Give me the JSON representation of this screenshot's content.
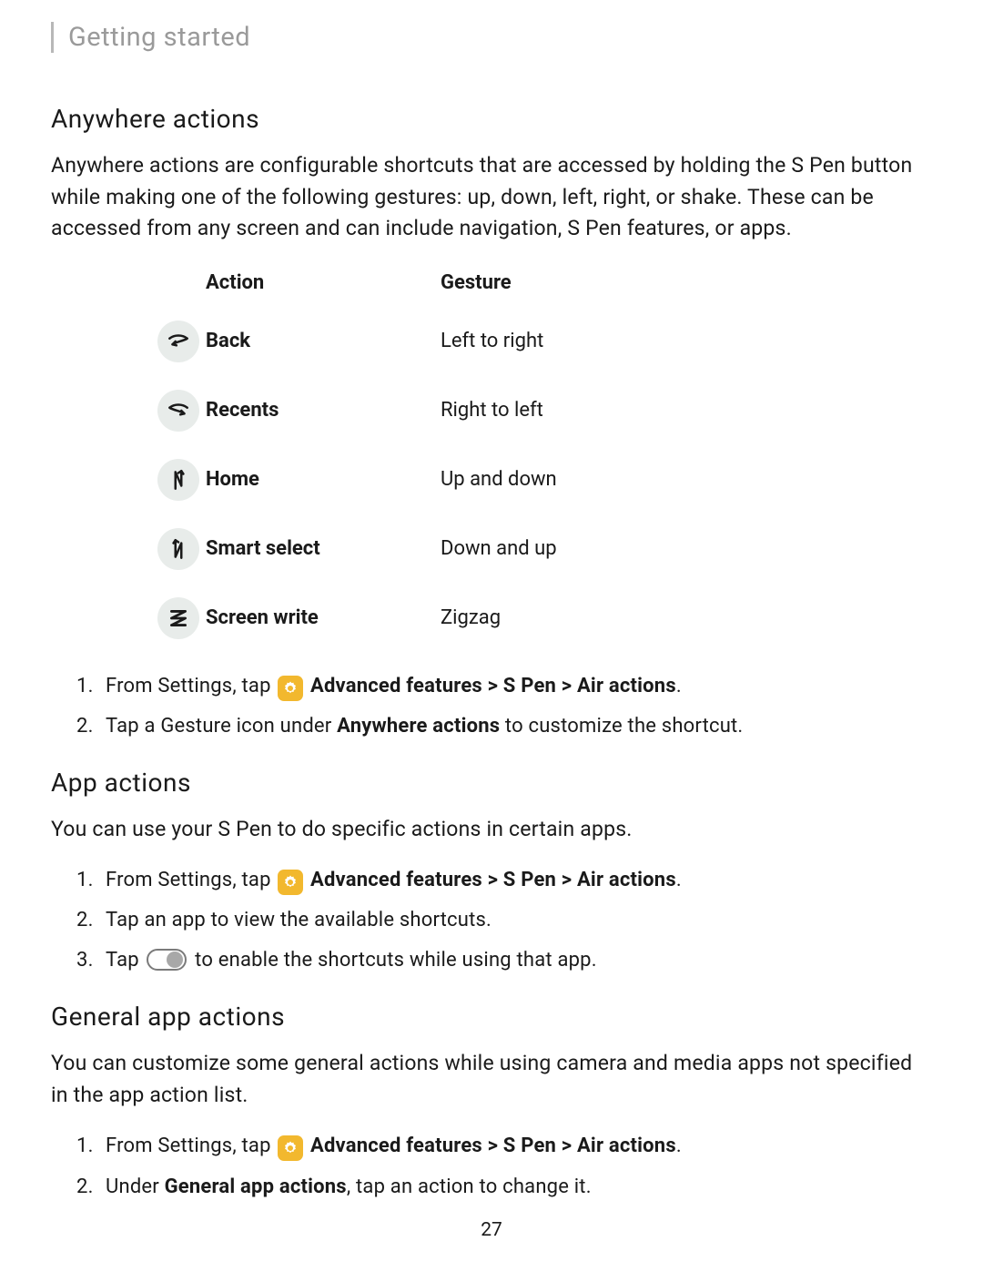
{
  "breadcrumb": "Getting started",
  "page_number": "27",
  "sections": {
    "anywhere": {
      "heading": "Anywhere actions",
      "body": "Anywhere actions are configurable shortcuts that are accessed by holding the S Pen button while making one of the following gestures: up, down, left, right, or shake. These can be accessed from any screen and can include navigation, S Pen features, or apps.",
      "table": {
        "header_action": "Action",
        "header_gesture": "Gesture",
        "rows": [
          {
            "action": "Back",
            "gesture": "Left to right"
          },
          {
            "action": "Recents",
            "gesture": "Right to left"
          },
          {
            "action": "Home",
            "gesture": "Up and down"
          },
          {
            "action": "Smart select",
            "gesture": "Down and up"
          },
          {
            "action": "Screen write",
            "gesture": "Zigzag"
          }
        ]
      },
      "steps": {
        "s1_pre": "From Settings, tap ",
        "s1_path": " Advanced features > S Pen > Air actions",
        "s1_post": ".",
        "s2_pre": "Tap a Gesture icon under ",
        "s2_b": "Anywhere actions",
        "s2_post": " to customize the shortcut."
      }
    },
    "app": {
      "heading": "App actions",
      "body": "You can use your S Pen to do specific actions in certain apps.",
      "steps": {
        "s1_pre": "From Settings, tap ",
        "s1_path": " Advanced features > S Pen > Air actions",
        "s1_post": ".",
        "s2": "Tap an app to view the available shortcuts.",
        "s3_pre": "Tap ",
        "s3_post": " to enable the shortcuts while using that app."
      }
    },
    "general": {
      "heading": "General app actions",
      "body": "You can customize some general actions while using camera and media apps not specified in the app action list.",
      "steps": {
        "s1_pre": "From Settings, tap ",
        "s1_path": " Advanced features > S Pen > Air actions",
        "s1_post": ".",
        "s2_pre": "Under ",
        "s2_b": "General app actions",
        "s2_post": ", tap an action to change it."
      }
    }
  }
}
